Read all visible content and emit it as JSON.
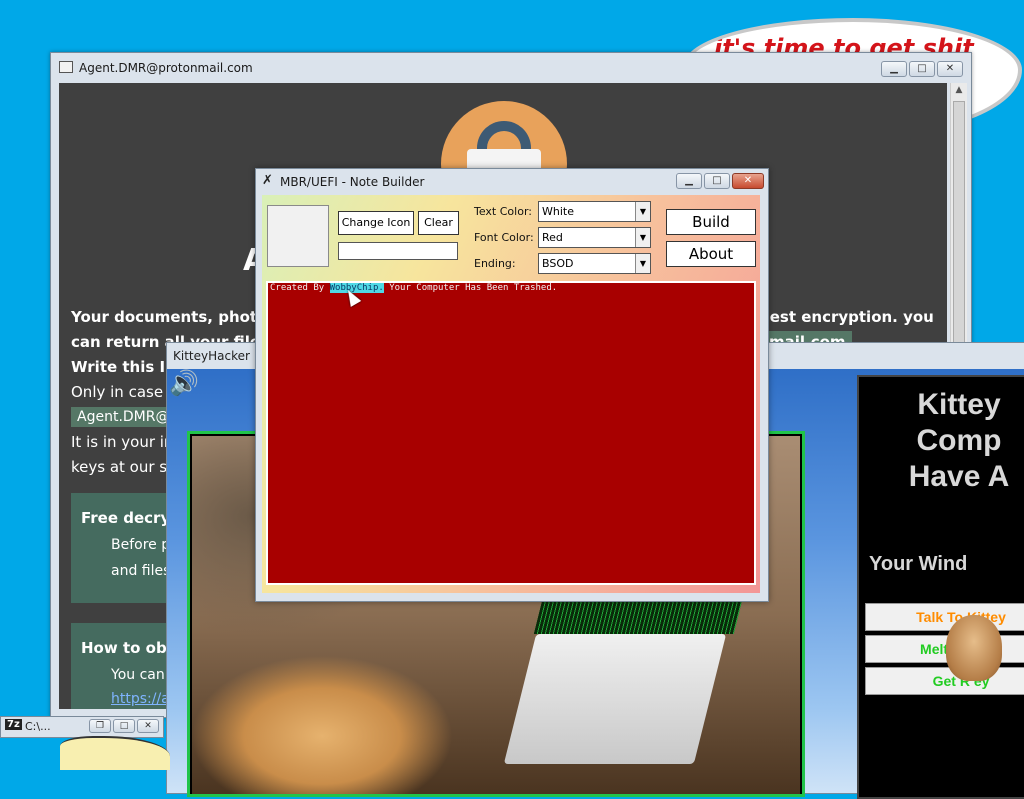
{
  "bubble": {
    "text": "it's time to get shit"
  },
  "agent_window": {
    "title": "Agent.DMR@protonmail.com",
    "big_heading": "A",
    "line1": "Your documents, photos,",
    "line1_right": "gest encryption. you",
    "line2": "can return all your files i",
    "line2_box": "mail.com",
    "line3": "Write this ID",
    "line4": "Only in case yo",
    "email_box": "Agent.DMR@a",
    "line5": "It is in your inte",
    "line6": "keys at our ser",
    "panel1": {
      "heading": "Free decryp",
      "lines": [
        "Before p",
        "and files"
      ]
    },
    "panel2": {
      "heading": "How to obta",
      "lines": [
        "You can"
      ],
      "link": "https://ac"
    }
  },
  "kittey_window": {
    "title": "KitteyHacker",
    "panel_title_lines": [
      "Kittey",
      "Comp",
      "Have A"
    ],
    "subtitle": "Your Wind",
    "buttons": [
      {
        "label": "Talk To Kittey",
        "color": "#ff8c00"
      },
      {
        "label": "Melt Yo    oute",
        "color": "#22cc22"
      },
      {
        "label": "Get R       ey",
        "color": "#22cc22"
      }
    ]
  },
  "note_builder": {
    "title": "MBR/UEFI - Note Builder",
    "change_icon_label": "Change Icon",
    "clear_label": "Clear",
    "icon_path_value": "",
    "text_color_label": "Text Color:",
    "text_color_value": "White",
    "font_color_label": "Font Color:",
    "font_color_value": "Red",
    "ending_label": "Ending:",
    "ending_value": "BSOD",
    "build_label": "Build",
    "about_label": "About",
    "preview_prefix": "Created By ",
    "preview_highlight": "WobbyChip.",
    "preview_suffix": " Your Computer Has Been Trashed."
  },
  "minimized_window": {
    "icon_text": "7z",
    "title": "C:\\..."
  },
  "colors": {
    "desktop": "#00a8e8",
    "preview_bg": "#a80000",
    "kittey_frame": "#21c44a"
  }
}
